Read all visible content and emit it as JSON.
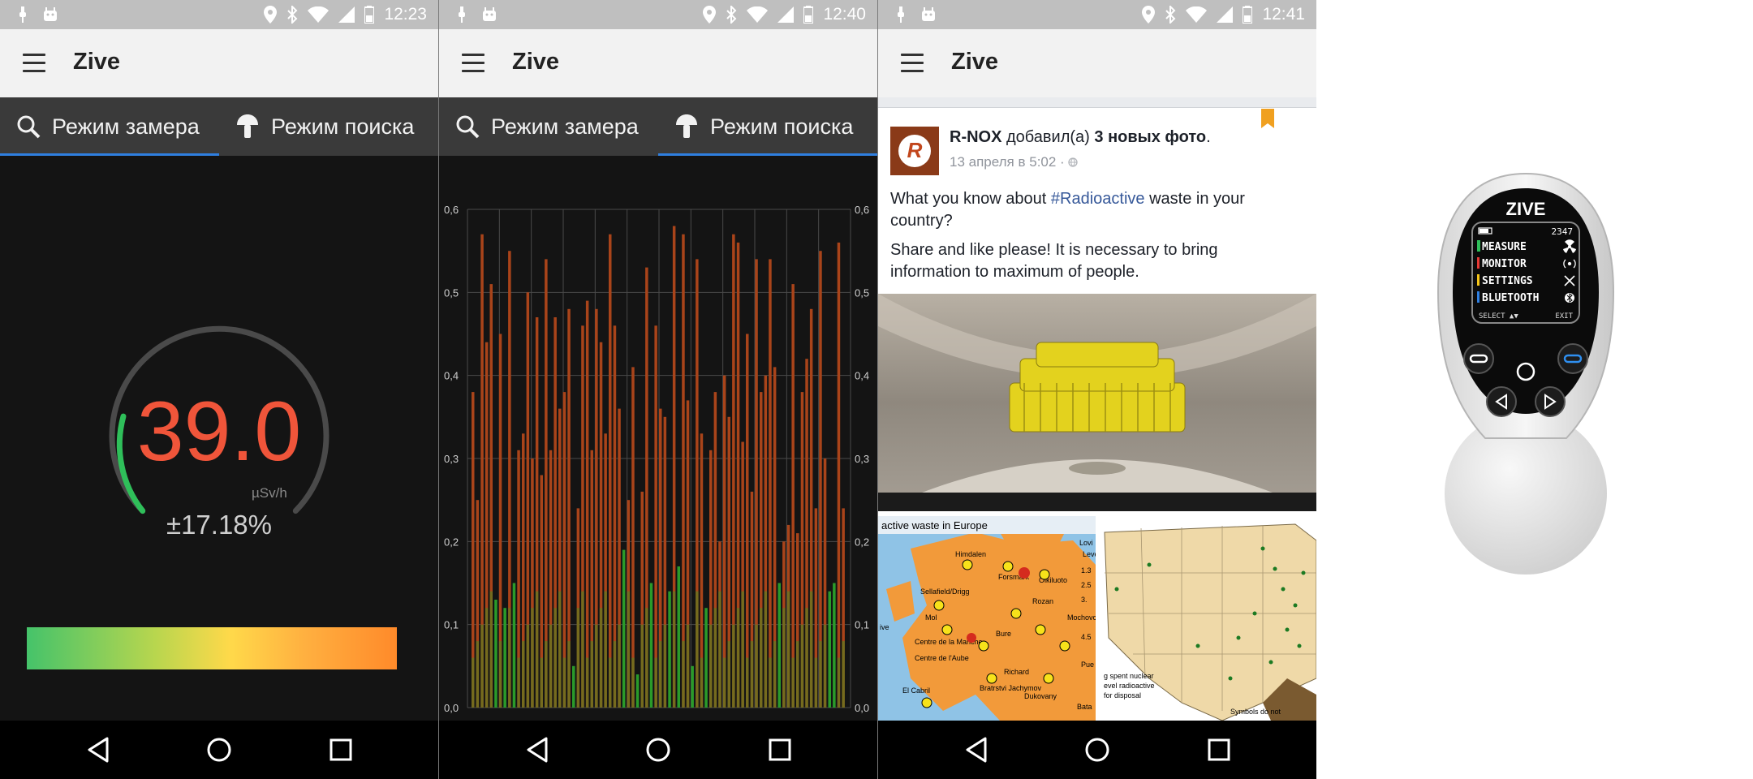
{
  "app": {
    "title": "Zive"
  },
  "screens": [
    {
      "status_time": "12:23"
    },
    {
      "status_time": "12:40"
    },
    {
      "status_time": "12:41"
    }
  ],
  "tabs": [
    {
      "label": "Режим замера",
      "icon": "search-icon"
    },
    {
      "label": "Режим поиска",
      "icon": "mushroom-icon"
    }
  ],
  "measure": {
    "value": "39.0",
    "unit": "µSv/h",
    "error": "±17.18%",
    "gauge_fraction": 0.3,
    "colors": {
      "value": "#f0553a",
      "arc_active": "#2fbf5a",
      "arc_track": "#4a4a4a"
    }
  },
  "chart_data": {
    "type": "bar",
    "ylim": [
      0,
      0.6
    ],
    "y_ticks": [
      "0,0",
      "0,1",
      "0,2",
      "0,3",
      "0,4",
      "0,5",
      "0,6"
    ],
    "grid": true,
    "series_colors": {
      "bars": "#a9441a",
      "low_bars": "#2a9b2a"
    },
    "values": [
      0.38,
      0.25,
      0.57,
      0.44,
      0.51,
      0.13,
      0.45,
      0.12,
      0.55,
      0.15,
      0.31,
      0.33,
      0.5,
      0.3,
      0.47,
      0.28,
      0.54,
      0.31,
      0.47,
      0.36,
      0.38,
      0.48,
      0.05,
      0.24,
      0.46,
      0.49,
      0.31,
      0.48,
      0.44,
      0.33,
      0.57,
      0.46,
      0.36,
      0.19,
      0.25,
      0.41,
      0.04,
      0.26,
      0.53,
      0.15,
      0.46,
      0.36,
      0.35,
      0.14,
      0.58,
      0.17,
      0.57,
      0.37,
      0.05,
      0.54,
      0.33,
      0.12,
      0.31,
      0.38,
      0.2,
      0.4,
      0.35,
      0.57,
      0.56,
      0.32,
      0.45,
      0.26,
      0.54,
      0.38,
      0.4,
      0.54,
      0.41,
      0.15,
      0.2,
      0.22,
      0.51,
      0.21,
      0.38,
      0.42,
      0.48,
      0.24,
      0.55,
      0.3,
      0.14,
      0.15,
      0.56,
      0.24
    ]
  },
  "feed": {
    "author": "R-NOX",
    "action_pre": " добавил(а) ",
    "action_bold": "3 новых фото",
    "action_post": ".",
    "date": "13 апреля в 5:02 · ",
    "text1_pre": "What you know about ",
    "hashtag": "#Radioactive",
    "text1_post": " waste in your country?",
    "text2": "Share and like please! It is necessary to bring information to maximum of people.",
    "photo2_title": "active waste in Europe",
    "photo2_places": [
      "Himdalen",
      "Forsmark",
      "Olkiluoto",
      "Lovi",
      "Sellafield/Drigg",
      "Mol",
      "Centre de la Manche",
      "Centre de l'Aube",
      "Bure",
      "Rozan",
      "Mochovce",
      "El Cabril",
      "Richard",
      "Bratrstvi Jachymov",
      "Dukovany",
      "Bata",
      "Pue",
      "1.3",
      "2.5",
      "3.",
      "4.5"
    ],
    "photo2_legend": [
      "Level",
      "ive"
    ],
    "photo3_caption": "Symbols do not",
    "photo3_lines": [
      "g spent nuclear",
      "evel radioactive",
      "for disposal"
    ]
  },
  "device": {
    "brand": "ZIVE",
    "counter": "2347",
    "menu": [
      {
        "label": "MEASURE",
        "color": "#2fbf5a",
        "icon": "radiation-icon"
      },
      {
        "label": "MONITOR",
        "color": "#e53935",
        "icon": "signal-icon"
      },
      {
        "label": "SETTINGS",
        "color": "#f5c518",
        "icon": "tools-icon"
      },
      {
        "label": "BLUETOOTH",
        "color": "#2f7fe0",
        "icon": "bluetooth-icon"
      }
    ],
    "footer_left": "SELECT ▲▼",
    "footer_right": "EXIT"
  }
}
